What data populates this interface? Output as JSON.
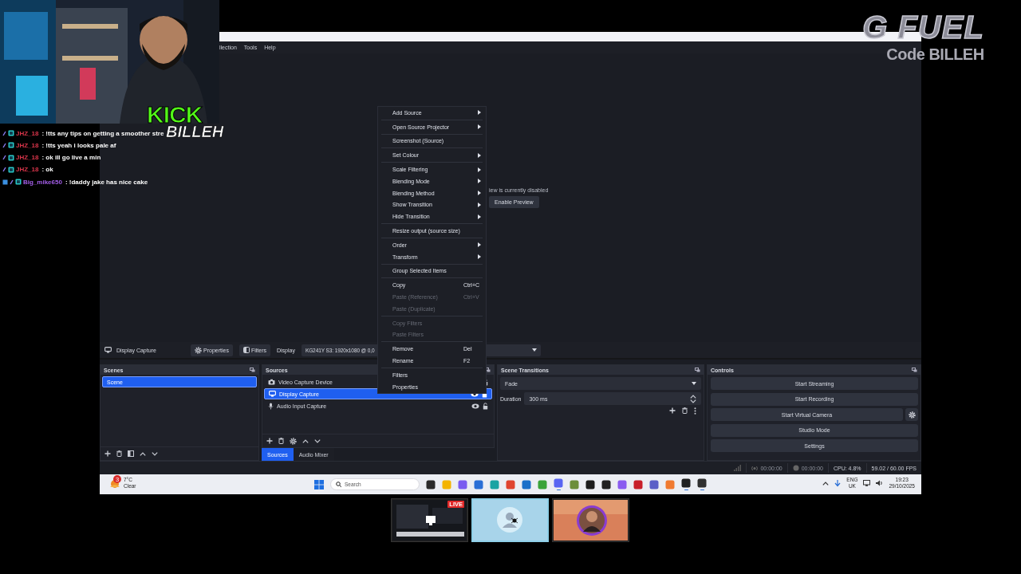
{
  "overlay": {
    "brand": "G FUEL",
    "promo": "Code BILLEH",
    "platform": "KICK",
    "channel": "BILLEH"
  },
  "chat": [
    {
      "user": "JHZ_18",
      "color": "#d8354a",
      "message": ": !tts any tips on getting a smoother stre",
      "subscriber": false
    },
    {
      "user": "JHZ_18",
      "color": "#d8354a",
      "message": ": !tts yeah i looks pale af",
      "subscriber": false
    },
    {
      "user": "JHZ_18",
      "color": "#d8354a",
      "message": ": ok ill go live a min",
      "subscriber": false
    },
    {
      "user": "JHZ_18",
      "color": "#d8354a",
      "message": ": ok",
      "subscriber": false
    },
    {
      "user": "Big_mike650",
      "color": "#a35ee8",
      "message": ": !daddy jake has nice cake",
      "subscriber": true
    }
  ],
  "obs": {
    "menu": [
      "llection",
      "Tools",
      "Help"
    ],
    "preview": {
      "message": "iew is currently disabled",
      "button": "Enable Preview"
    },
    "source_bar": {
      "source": "Display Capture",
      "properties": "Properties",
      "filters": "Filters",
      "label": "Display",
      "value": "KG241Y S3: 1920x1080 @ 0,0"
    },
    "scenes": {
      "title": "Scenes",
      "items": [
        {
          "label": "Scene",
          "selected": true
        }
      ]
    },
    "sources": {
      "title": "Sources",
      "items": [
        {
          "label": "Video Capture Device",
          "kind": "camera",
          "selected": false
        },
        {
          "label": "Display Capture",
          "kind": "display",
          "selected": true,
          "visible": true
        },
        {
          "label": "Audio Input Capture",
          "kind": "audio",
          "selected": false,
          "visible": true
        }
      ]
    },
    "dock_tabs": [
      {
        "label": "Sources",
        "selected": true
      },
      {
        "label": "Audio Mixer",
        "selected": false
      }
    ],
    "transitions": {
      "title": "Scene Transitions",
      "transition": "Fade",
      "duration_label": "Duration",
      "duration": "300 ms"
    },
    "controls": {
      "title": "Controls",
      "buttons": [
        {
          "label": "Start Streaming",
          "settings": false
        },
        {
          "label": "Start Recording",
          "settings": false
        },
        {
          "label": "Start Virtual Camera",
          "settings": true
        },
        {
          "label": "Studio Mode",
          "settings": false
        },
        {
          "label": "Settings",
          "settings": false
        }
      ]
    },
    "status": {
      "stream_time": "00:00:00",
      "record_time": "00:00:00",
      "cpu": "CPU: 4.8%",
      "fps": "59.02 / 60.00 FPS"
    }
  },
  "context_menu": {
    "groups": [
      {
        "items": [
          {
            "label": "Add Source",
            "submenu": true,
            "disabled": false
          }
        ]
      },
      {
        "items": [
          {
            "label": "Open Source Projector",
            "submenu": true,
            "disabled": false
          }
        ]
      },
      {
        "items": [
          {
            "label": "Screenshot (Source)",
            "submenu": false,
            "disabled": false
          }
        ]
      },
      {
        "items": [
          {
            "label": "Set Colour",
            "submenu": true,
            "disabled": false
          }
        ]
      },
      {
        "items": [
          {
            "label": "Scale Filtering",
            "submenu": true,
            "disabled": false
          },
          {
            "label": "Blending Mode",
            "submenu": true,
            "disabled": false
          },
          {
            "label": "Blending Method",
            "submenu": true,
            "disabled": false
          },
          {
            "label": "Show Transition",
            "submenu": true,
            "disabled": false
          },
          {
            "label": "Hide Transition",
            "submenu": true,
            "disabled": false
          }
        ]
      },
      {
        "items": [
          {
            "label": "Resize output (source size)",
            "submenu": false,
            "disabled": false
          }
        ]
      },
      {
        "items": [
          {
            "label": "Order",
            "submenu": true,
            "disabled": false
          },
          {
            "label": "Transform",
            "submenu": true,
            "disabled": false
          }
        ]
      },
      {
        "items": [
          {
            "label": "Group Selected Items",
            "submenu": false,
            "disabled": false
          }
        ]
      },
      {
        "items": [
          {
            "label": "Copy",
            "shortcut": "Ctrl+C",
            "submenu": false,
            "disabled": false
          },
          {
            "label": "Paste (Reference)",
            "shortcut": "Ctrl+V",
            "submenu": false,
            "disabled": true
          },
          {
            "label": "Paste (Duplicate)",
            "submenu": false,
            "disabled": true
          }
        ]
      },
      {
        "items": [
          {
            "label": "Copy Filters",
            "submenu": false,
            "disabled": true
          },
          {
            "label": "Paste Filters",
            "submenu": false,
            "disabled": true
          }
        ]
      },
      {
        "items": [
          {
            "label": "Remove",
            "shortcut": "Del",
            "submenu": false,
            "disabled": false
          },
          {
            "label": "Rename",
            "shortcut": "F2",
            "submenu": false,
            "disabled": false
          }
        ]
      },
      {
        "items": [
          {
            "label": "Filters",
            "submenu": false,
            "disabled": false
          },
          {
            "label": "Properties",
            "submenu": false,
            "disabled": false
          }
        ]
      }
    ]
  },
  "taskbar": {
    "weather": {
      "temp": "7°C",
      "condition": "Clear",
      "badge": "3"
    },
    "search": {
      "placeholder": "Search"
    },
    "apps": [
      {
        "color": "#2b2b2b",
        "running": false
      },
      {
        "color": "#f4b400",
        "running": false
      },
      {
        "color": "#7a5cf0",
        "running": false
      },
      {
        "color": "#2a6fd6",
        "running": false
      },
      {
        "color": "#1aa3a3",
        "running": false
      },
      {
        "color": "#e0442f",
        "running": false
      },
      {
        "color": "#1a6fc9",
        "running": false
      },
      {
        "color": "#3aa33a",
        "running": false
      },
      {
        "color": "#5865f2",
        "running": true
      },
      {
        "color": "#6b8e3a",
        "running": false
      },
      {
        "color": "#1c1c1c",
        "running": false
      },
      {
        "color": "#202020",
        "running": false
      },
      {
        "color": "#8a5cf0",
        "running": false
      },
      {
        "color": "#c8202a",
        "running": false
      },
      {
        "color": "#5b5fc7",
        "running": false
      },
      {
        "color": "#f07a30",
        "running": false
      },
      {
        "color": "#202020",
        "running": true
      },
      {
        "color": "#303030",
        "running": true
      }
    ],
    "language": "ENG",
    "region": "UK",
    "time": "19:23",
    "date": "29/10/2025"
  },
  "call_tiles": [
    {
      "kind": "screen",
      "badge": "LIVE",
      "selected": false
    },
    {
      "kind": "avatar",
      "selected": true
    },
    {
      "kind": "camera",
      "selected": false
    }
  ]
}
